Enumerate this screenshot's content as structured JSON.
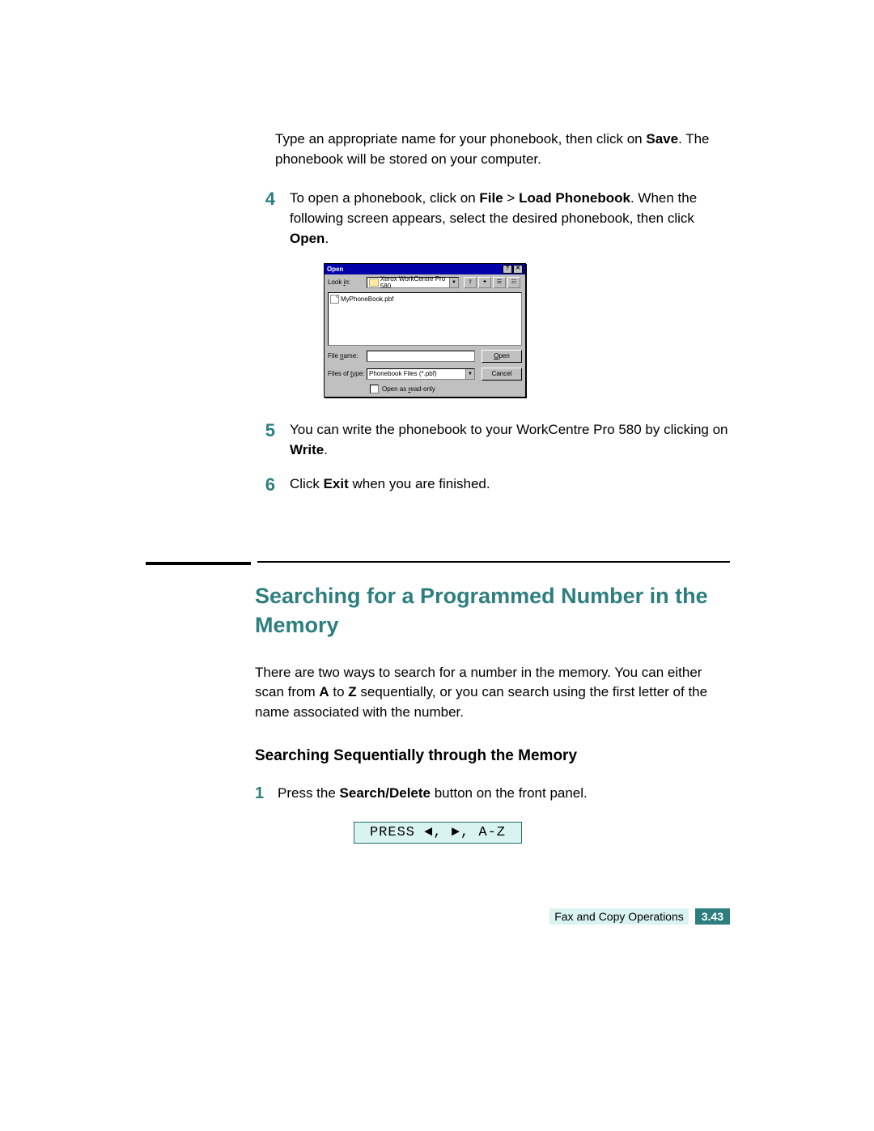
{
  "intro": {
    "p1a": "Type an appropriate name for your phonebook, then click on ",
    "save": "Save",
    "p1b": ". The phonebook will be stored on your computer."
  },
  "steps": {
    "s4": {
      "num": "4",
      "a": "To open a phonebook, click on ",
      "file": "File",
      "gt": " > ",
      "load": "Load Phonebook",
      "b": ". When the following screen appears, select the desired phonebook, then click ",
      "open": "Open",
      "c": "."
    },
    "s5": {
      "num": "5",
      "a": "You can write the phonebook to your WorkCentre Pro 580 by clicking on ",
      "write": "Write",
      "b": "."
    },
    "s6": {
      "num": "6",
      "a": "Click ",
      "exit": "Exit",
      "b": " when you are finished."
    }
  },
  "dialog": {
    "title": "Open",
    "help": "?",
    "close": "✕",
    "look_in_lbl": "Look in:",
    "look_in_ul": "i",
    "folder": "Xerox WorkCentre Pro 580",
    "file_item": "MyPhoneBook.pbf",
    "filename_lbl": "File name:",
    "filename_ul": "n",
    "filetype_lbl": "Files of type:",
    "filetype_ul": "t",
    "filetype_val": "Phonebook Files (*.pbf)",
    "open_btn": "Open",
    "open_ul": "O",
    "cancel_btn": "Cancel",
    "readonly": "Open as read-only",
    "readonly_ul": "r"
  },
  "section": {
    "h2": "Searching for a Programmed Number in the Memory",
    "p_a": "There are two ways to search for a number in the memory. You can either scan from ",
    "a": "A",
    "p_b": " to ",
    "z": "Z",
    "p_c": " sequentially, or you can search using the first letter of the name associated with the number.",
    "h3": "Searching Sequentially through the Memory",
    "s1": {
      "num": "1",
      "a": "Press the ",
      "btn": "Search/Delete",
      "b": " button on the front panel."
    },
    "lcd": "PRESS ◄, ►, A-Z"
  },
  "footer": {
    "label": "Fax and Copy Operations",
    "page": "3.43"
  }
}
